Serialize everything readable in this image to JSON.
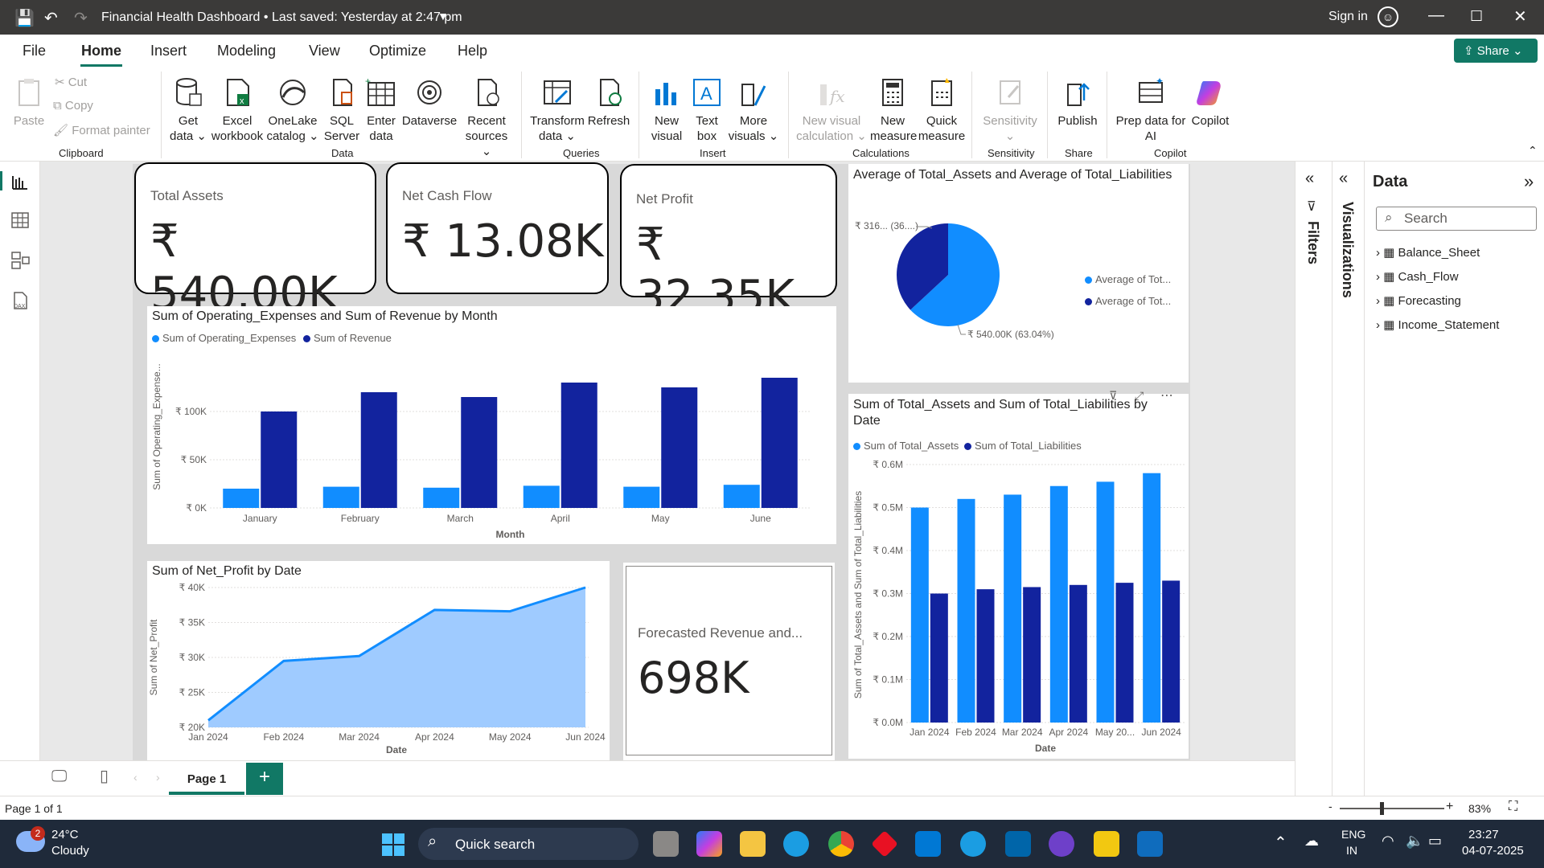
{
  "titlebar": {
    "title": "Financial Health Dashboard • Last saved: Yesterday at 2:47 pm",
    "signin": "Sign in"
  },
  "menu": {
    "file": "File",
    "home": "Home",
    "insert": "Insert",
    "modeling": "Modeling",
    "view": "View",
    "optimize": "Optimize",
    "help": "Help",
    "share": "Share"
  },
  "ribbon": {
    "paste": "Paste",
    "cut": "Cut",
    "copy": "Copy",
    "format_painter": "Format painter",
    "clipboard": "Clipboard",
    "get_data": "Get data",
    "excel": "Excel workbook",
    "onelake": "OneLake catalog",
    "sql": "SQL Server",
    "enter": "Enter data",
    "dataverse": "Dataverse",
    "recent": "Recent sources",
    "data": "Data",
    "transform": "Transform data",
    "refresh": "Refresh",
    "queries": "Queries",
    "new_visual": "New visual",
    "text_box": "Text box",
    "more_visuals": "More visuals",
    "insert": "Insert",
    "new_visual_calc": "New visual calculation",
    "new_measure": "New measure",
    "quick_measure": "Quick measure",
    "calculations": "Calculations",
    "sensitivity_btn": "Sensitivity",
    "sensitivity": "Sensitivity",
    "publish": "Publish",
    "share": "Share",
    "prep_ai": "Prep data for AI",
    "copilot_btn": "Copilot",
    "copilot": "Copilot"
  },
  "cards": [
    {
      "label": "Total Assets",
      "value": "₹ 540.00K"
    },
    {
      "label": "Net Cash Flow",
      "value": "₹ 13.08K"
    },
    {
      "label": "Net Profit",
      "value": "₹ 32.35K"
    }
  ],
  "forecast_card": {
    "label": "Forecasted Revenue and...",
    "value": "698K"
  },
  "colors": {
    "light": "#118dff",
    "dark": "#12239e",
    "area": "#9fcbff"
  },
  "charts": {
    "pie": {
      "title": "Average of Total_Assets and Average of Total_Liabilities",
      "legend": [
        "Average of Tot...",
        "Average of Tot..."
      ],
      "label_small": "₹ 316... (36....)",
      "label_large": "₹ 540.00K (63.04%)"
    },
    "opex": {
      "title": "Sum of Operating_Expenses and Sum of Revenue by Month",
      "legend": [
        "Sum of Operating_Expenses",
        "Sum of Revenue"
      ],
      "ylabel": "Sum of Operating_Expense...",
      "xlabel": "Month",
      "yticks": [
        "₹ 0K",
        "₹ 50K",
        "₹ 100K"
      ]
    },
    "netprofit": {
      "title": "Sum of Net_Profit by Date",
      "ylabel": "Sum of Net_Profit",
      "xlabel": "Date",
      "yticks": [
        "₹ 20K",
        "₹ 25K",
        "₹ 30K",
        "₹ 35K",
        "₹ 40K"
      ]
    },
    "assets": {
      "title": "Sum of Total_Assets and Sum of Total_Liabilities by Date",
      "legend": [
        "Sum of Total_Assets",
        "Sum of Total_Liabilities"
      ],
      "ylabel": "Sum of Total_Assets and Sum of Total_Liabilities",
      "xlabel": "Date",
      "yticks": [
        "₹ 0.0M",
        "₹ 0.1M",
        "₹ 0.2M",
        "₹ 0.3M",
        "₹ 0.4M",
        "₹ 0.5M",
        "₹ 0.6M"
      ]
    }
  },
  "chart_data": [
    {
      "type": "pie",
      "title": "Average of Total_Assets and Average of Total_Liabilities",
      "slices": [
        {
          "name": "Average of Tot...",
          "value": 540000,
          "percent": 63.04
        },
        {
          "name": "Average of Tot...",
          "value": 316000,
          "percent": 36.96
        }
      ]
    },
    {
      "type": "bar",
      "title": "Sum of Operating_Expenses and Sum of Revenue by Month",
      "categories": [
        "January",
        "February",
        "March",
        "April",
        "May",
        "June"
      ],
      "series": [
        {
          "name": "Sum of Operating_Expenses",
          "values": [
            20000,
            22000,
            21000,
            23000,
            22000,
            24000
          ]
        },
        {
          "name": "Sum of Revenue",
          "values": [
            100000,
            120000,
            115000,
            130000,
            125000,
            135000
          ]
        }
      ],
      "ylim": [
        0,
        100000
      ],
      "xlabel": "Month",
      "ylabel": "Sum of Operating_Expense..."
    },
    {
      "type": "area",
      "title": "Sum of Net_Profit by Date",
      "categories": [
        "Jan 2024",
        "Feb 2024",
        "Mar 2024",
        "Apr 2024",
        "May 2024",
        "Jun 2024"
      ],
      "values": [
        21000,
        29500,
        30200,
        36800,
        36600,
        40000
      ],
      "ylim": [
        20000,
        40000
      ],
      "xlabel": "Date",
      "ylabel": "Sum of Net_Profit"
    },
    {
      "type": "bar",
      "title": "Sum of Total_Assets and Sum of Total_Liabilities by Date",
      "categories": [
        "Jan 2024",
        "Feb 2024",
        "Mar 2024",
        "Apr 2024",
        "May 20...",
        "Jun 2024"
      ],
      "series": [
        {
          "name": "Sum of Total_Assets",
          "values": [
            500000,
            520000,
            530000,
            550000,
            560000,
            580000
          ]
        },
        {
          "name": "Sum of Total_Liabilities",
          "values": [
            300000,
            310000,
            315000,
            320000,
            325000,
            330000
          ]
        }
      ],
      "ylim": [
        0,
        600000
      ],
      "xlabel": "Date",
      "ylabel": "Sum of Total_Assets and Sum of Total_Liabilities"
    }
  ],
  "panes": {
    "filters": "Filters",
    "visualizations": "Visualizations",
    "data": "Data",
    "search_placeholder": "Search",
    "tables": [
      "Balance_Sheet",
      "Cash_Flow",
      "Forecasting",
      "Income_Statement"
    ]
  },
  "pages": {
    "tab": "Page 1",
    "status": "Page 1 of 1",
    "zoom": "83%"
  },
  "taskbar": {
    "weather_temp": "24°C",
    "weather_desc": "Cloudy",
    "weather_badge": "2",
    "search": "Quick search",
    "lang1": "ENG",
    "lang2": "IN",
    "time": "23:27",
    "date": "04-07-2025"
  },
  "icons": [
    "save-icon",
    "undo-icon",
    "redo-icon",
    "profile-icon",
    "minimize-icon",
    "maximize-icon",
    "close-icon",
    "report-view-icon",
    "table-view-icon",
    "model-view-icon",
    "dax-query-icon",
    "windows-start-icon"
  ]
}
